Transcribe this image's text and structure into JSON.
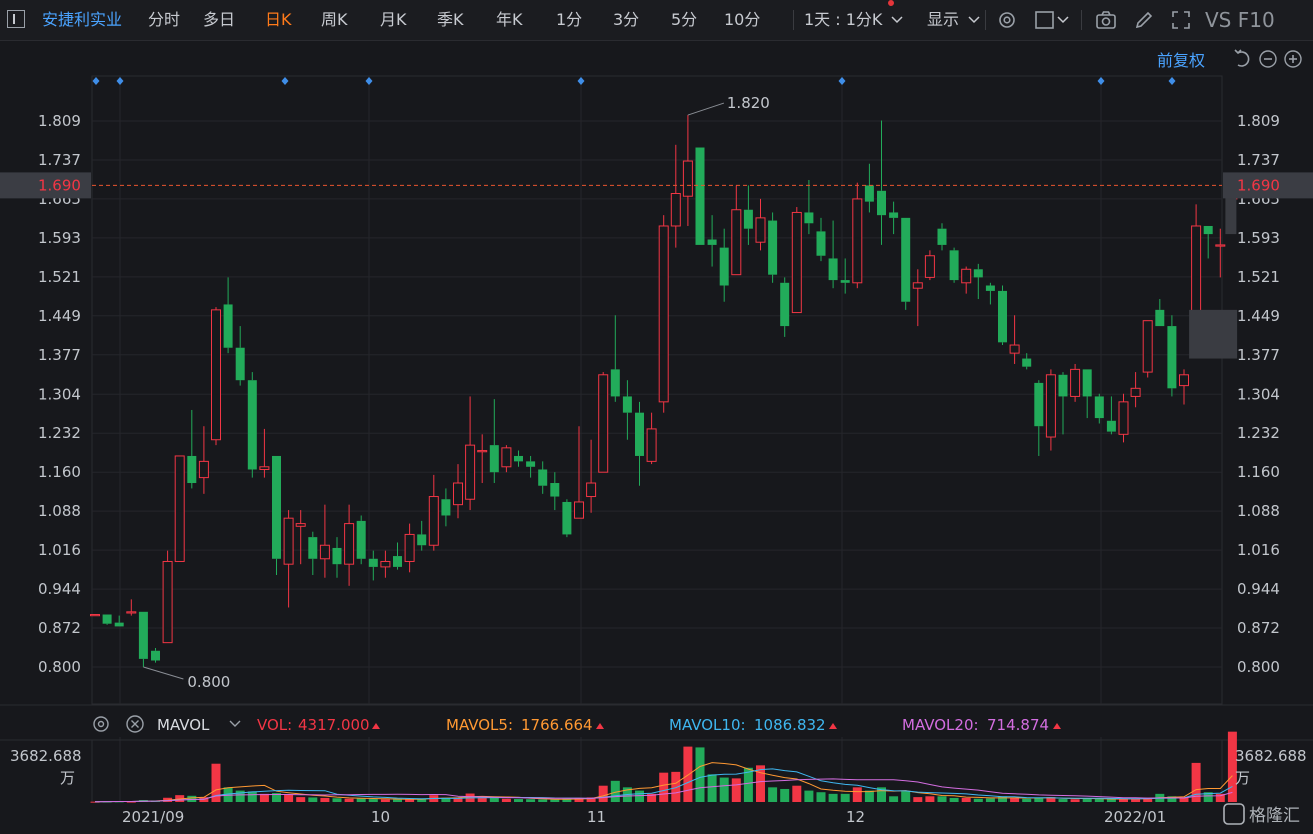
{
  "toolbar": {
    "stock_name": "安捷利实业",
    "tabs": [
      "分时",
      "多日",
      "日K",
      "周K",
      "月K",
      "季K",
      "年K",
      "1分",
      "3分",
      "5分",
      "10分"
    ],
    "active_tab": "日K",
    "interval": "1天 : 1分K",
    "display": "显示",
    "right_text": "VS F10",
    "adjust": "前复权"
  },
  "colors": {
    "up": "#f23645",
    "down": "#22ab5a",
    "bg": "#17181c",
    "price_line": "#e8532e",
    "mavol5": "#ff9933",
    "mavol10": "#3fb7f0",
    "mavol20": "#d36de0"
  },
  "main_axis": {
    "ticks": [
      "1.809",
      "1.737",
      "1.665",
      "1.593",
      "1.521",
      "1.449",
      "1.377",
      "1.304",
      "1.232",
      "1.160",
      "1.088",
      "1.016",
      "0.944",
      "0.872",
      "0.800"
    ],
    "current_price": "1.690",
    "max_label": "1.820",
    "min_label": "0.800"
  },
  "x_labels": [
    "2021/09",
    "10",
    "11",
    "12",
    "2022/01"
  ],
  "volume_legend": {
    "name": "MAVOL",
    "vol_label": "VOL:",
    "vol_value": "4317.000",
    "mavol5_label": "MAVOL5:",
    "mavol5_value": "1766.664",
    "mavol10_label": "MAVOL10:",
    "mavol10_value": "1086.832",
    "mavol20_label": "MAVOL20:",
    "mavol20_value": "714.874"
  },
  "volume_axis": {
    "top": "3682.688",
    "unit": "万"
  },
  "watermark": "格隆汇",
  "chart_data": {
    "type": "candlestick",
    "title": "安捷利实业",
    "period": "日K",
    "ylim": [
      0.77,
      1.84
    ],
    "x_ticks": [
      "2021/09",
      "10",
      "11",
      "12",
      "2022/01"
    ],
    "candles": [
      {
        "o": 0.897,
        "h": 0.897,
        "l": 0.897,
        "c": 0.897,
        "v": 20
      },
      {
        "o": 0.897,
        "h": 0.897,
        "l": 0.878,
        "c": 0.88,
        "v": 30
      },
      {
        "o": 0.882,
        "h": 0.895,
        "l": 0.875,
        "c": 0.875,
        "v": 40
      },
      {
        "o": 0.9,
        "h": 0.925,
        "l": 0.895,
        "c": 0.902,
        "v": 25
      },
      {
        "o": 0.902,
        "h": 0.902,
        "l": 0.8,
        "c": 0.815,
        "v": 120
      },
      {
        "o": 0.83,
        "h": 0.835,
        "l": 0.808,
        "c": 0.812,
        "v": 90
      },
      {
        "o": 0.845,
        "h": 1.015,
        "l": 0.845,
        "c": 0.995,
        "v": 260
      },
      {
        "o": 0.995,
        "h": 1.19,
        "l": 0.995,
        "c": 1.19,
        "v": 420
      },
      {
        "o": 1.19,
        "h": 1.275,
        "l": 1.13,
        "c": 1.14,
        "v": 380
      },
      {
        "o": 1.15,
        "h": 1.245,
        "l": 1.12,
        "c": 1.18,
        "v": 300
      },
      {
        "o": 1.22,
        "h": 1.465,
        "l": 1.21,
        "c": 1.46,
        "v": 2350
      },
      {
        "o": 1.47,
        "h": 1.52,
        "l": 1.38,
        "c": 1.39,
        "v": 900
      },
      {
        "o": 1.39,
        "h": 1.43,
        "l": 1.32,
        "c": 1.33,
        "v": 700
      },
      {
        "o": 1.33,
        "h": 1.345,
        "l": 1.15,
        "c": 1.165,
        "v": 650
      },
      {
        "o": 1.165,
        "h": 1.24,
        "l": 1.15,
        "c": 1.17,
        "v": 500
      },
      {
        "o": 1.19,
        "h": 1.19,
        "l": 0.97,
        "c": 1.0,
        "v": 550
      },
      {
        "o": 0.99,
        "h": 1.09,
        "l": 0.91,
        "c": 1.075,
        "v": 450
      },
      {
        "o": 1.06,
        "h": 1.09,
        "l": 0.99,
        "c": 1.065,
        "v": 300
      },
      {
        "o": 1.04,
        "h": 1.05,
        "l": 0.97,
        "c": 1.0,
        "v": 280
      },
      {
        "o": 1.0,
        "h": 1.1,
        "l": 0.965,
        "c": 1.025,
        "v": 250
      },
      {
        "o": 1.02,
        "h": 1.04,
        "l": 0.965,
        "c": 0.99,
        "v": 230
      },
      {
        "o": 0.99,
        "h": 1.1,
        "l": 0.95,
        "c": 1.065,
        "v": 200
      },
      {
        "o": 1.07,
        "h": 1.08,
        "l": 0.99,
        "c": 1.0,
        "v": 210
      },
      {
        "o": 1.0,
        "h": 1.015,
        "l": 0.96,
        "c": 0.985,
        "v": 180
      },
      {
        "o": 0.985,
        "h": 1.015,
        "l": 0.965,
        "c": 0.995,
        "v": 160
      },
      {
        "o": 1.005,
        "h": 1.03,
        "l": 0.98,
        "c": 0.985,
        "v": 150
      },
      {
        "o": 0.995,
        "h": 1.065,
        "l": 0.975,
        "c": 1.045,
        "v": 170
      },
      {
        "o": 1.045,
        "h": 1.07,
        "l": 1.015,
        "c": 1.025,
        "v": 200
      },
      {
        "o": 1.025,
        "h": 1.155,
        "l": 1.015,
        "c": 1.115,
        "v": 420
      },
      {
        "o": 1.11,
        "h": 1.13,
        "l": 1.06,
        "c": 1.08,
        "v": 260
      },
      {
        "o": 1.1,
        "h": 1.175,
        "l": 1.075,
        "c": 1.14,
        "v": 230
      },
      {
        "o": 1.11,
        "h": 1.3,
        "l": 1.09,
        "c": 1.21,
        "v": 520
      },
      {
        "o": 1.2,
        "h": 1.23,
        "l": 1.14,
        "c": 1.2,
        "v": 300
      },
      {
        "o": 1.21,
        "h": 1.295,
        "l": 1.14,
        "c": 1.16,
        "v": 280
      },
      {
        "o": 1.17,
        "h": 1.21,
        "l": 1.16,
        "c": 1.205,
        "v": 200
      },
      {
        "o": 1.19,
        "h": 1.2,
        "l": 1.17,
        "c": 1.18,
        "v": 180
      },
      {
        "o": 1.18,
        "h": 1.19,
        "l": 1.15,
        "c": 1.17,
        "v": 170
      },
      {
        "o": 1.165,
        "h": 1.18,
        "l": 1.12,
        "c": 1.135,
        "v": 160
      },
      {
        "o": 1.14,
        "h": 1.16,
        "l": 1.09,
        "c": 1.115,
        "v": 150
      },
      {
        "o": 1.105,
        "h": 1.11,
        "l": 1.04,
        "c": 1.045,
        "v": 200
      },
      {
        "o": 1.075,
        "h": 1.245,
        "l": 1.075,
        "c": 1.105,
        "v": 240
      },
      {
        "o": 1.115,
        "h": 1.22,
        "l": 1.085,
        "c": 1.14,
        "v": 280
      },
      {
        "o": 1.16,
        "h": 1.345,
        "l": 1.16,
        "c": 1.34,
        "v": 1000
      },
      {
        "o": 1.35,
        "h": 1.45,
        "l": 1.29,
        "c": 1.3,
        "v": 1300
      },
      {
        "o": 1.3,
        "h": 1.33,
        "l": 1.22,
        "c": 1.27,
        "v": 900
      },
      {
        "o": 1.27,
        "h": 1.29,
        "l": 1.135,
        "c": 1.19,
        "v": 700
      },
      {
        "o": 1.18,
        "h": 1.27,
        "l": 1.175,
        "c": 1.24,
        "v": 500
      },
      {
        "o": 1.29,
        "h": 1.635,
        "l": 1.27,
        "c": 1.615,
        "v": 1800
      },
      {
        "o": 1.615,
        "h": 1.765,
        "l": 1.575,
        "c": 1.675,
        "v": 1850
      },
      {
        "o": 1.67,
        "h": 1.82,
        "l": 1.615,
        "c": 1.735,
        "v": 3400
      },
      {
        "o": 1.76,
        "h": 1.76,
        "l": 1.58,
        "c": 1.58,
        "v": 3350
      },
      {
        "o": 1.59,
        "h": 1.635,
        "l": 1.54,
        "c": 1.58,
        "v": 1700
      },
      {
        "o": 1.575,
        "h": 1.61,
        "l": 1.475,
        "c": 1.505,
        "v": 1500
      },
      {
        "o": 1.525,
        "h": 1.69,
        "l": 1.525,
        "c": 1.645,
        "v": 1450
      },
      {
        "o": 1.645,
        "h": 1.69,
        "l": 1.58,
        "c": 1.61,
        "v": 2100
      },
      {
        "o": 1.585,
        "h": 1.665,
        "l": 1.57,
        "c": 1.63,
        "v": 2250
      },
      {
        "o": 1.625,
        "h": 1.64,
        "l": 1.51,
        "c": 1.525,
        "v": 900
      },
      {
        "o": 1.51,
        "h": 1.52,
        "l": 1.41,
        "c": 1.43,
        "v": 800
      },
      {
        "o": 1.455,
        "h": 1.65,
        "l": 1.455,
        "c": 1.64,
        "v": 1000
      },
      {
        "o": 1.64,
        "h": 1.7,
        "l": 1.6,
        "c": 1.62,
        "v": 700
      },
      {
        "o": 1.605,
        "h": 1.63,
        "l": 1.55,
        "c": 1.56,
        "v": 600
      },
      {
        "o": 1.555,
        "h": 1.625,
        "l": 1.5,
        "c": 1.515,
        "v": 500
      },
      {
        "o": 1.515,
        "h": 1.555,
        "l": 1.49,
        "c": 1.51,
        "v": 500
      },
      {
        "o": 1.51,
        "h": 1.695,
        "l": 1.5,
        "c": 1.665,
        "v": 900
      },
      {
        "o": 1.69,
        "h": 1.73,
        "l": 1.64,
        "c": 1.66,
        "v": 700
      },
      {
        "o": 1.68,
        "h": 1.81,
        "l": 1.58,
        "c": 1.635,
        "v": 900
      },
      {
        "o": 1.64,
        "h": 1.66,
        "l": 1.6,
        "c": 1.63,
        "v": 350
      },
      {
        "o": 1.63,
        "h": 1.63,
        "l": 1.46,
        "c": 1.475,
        "v": 650
      },
      {
        "o": 1.5,
        "h": 1.535,
        "l": 1.43,
        "c": 1.51,
        "v": 300
      },
      {
        "o": 1.52,
        "h": 1.57,
        "l": 1.515,
        "c": 1.56,
        "v": 350
      },
      {
        "o": 1.61,
        "h": 1.62,
        "l": 1.57,
        "c": 1.58,
        "v": 350
      },
      {
        "o": 1.57,
        "h": 1.575,
        "l": 1.51,
        "c": 1.515,
        "v": 250
      },
      {
        "o": 1.51,
        "h": 1.54,
        "l": 1.49,
        "c": 1.535,
        "v": 250
      },
      {
        "o": 1.535,
        "h": 1.545,
        "l": 1.48,
        "c": 1.52,
        "v": 200
      },
      {
        "o": 1.505,
        "h": 1.51,
        "l": 1.47,
        "c": 1.495,
        "v": 220
      },
      {
        "o": 1.495,
        "h": 1.505,
        "l": 1.395,
        "c": 1.4,
        "v": 350
      },
      {
        "o": 1.38,
        "h": 1.45,
        "l": 1.36,
        "c": 1.395,
        "v": 250
      },
      {
        "o": 1.37,
        "h": 1.38,
        "l": 1.35,
        "c": 1.355,
        "v": 200
      },
      {
        "o": 1.325,
        "h": 1.33,
        "l": 1.19,
        "c": 1.245,
        "v": 220
      },
      {
        "o": 1.225,
        "h": 1.35,
        "l": 1.2,
        "c": 1.34,
        "v": 300
      },
      {
        "o": 1.34,
        "h": 1.345,
        "l": 1.23,
        "c": 1.3,
        "v": 180
      },
      {
        "o": 1.3,
        "h": 1.36,
        "l": 1.29,
        "c": 1.35,
        "v": 170
      },
      {
        "o": 1.35,
        "h": 1.35,
        "l": 1.26,
        "c": 1.3,
        "v": 200
      },
      {
        "o": 1.3,
        "h": 1.305,
        "l": 1.25,
        "c": 1.26,
        "v": 190
      },
      {
        "o": 1.255,
        "h": 1.3,
        "l": 1.23,
        "c": 1.235,
        "v": 180
      },
      {
        "o": 1.23,
        "h": 1.305,
        "l": 1.215,
        "c": 1.29,
        "v": 170
      },
      {
        "o": 1.3,
        "h": 1.345,
        "l": 1.28,
        "c": 1.315,
        "v": 200
      },
      {
        "o": 1.345,
        "h": 1.44,
        "l": 1.335,
        "c": 1.44,
        "v": 260
      },
      {
        "o": 1.46,
        "h": 1.48,
        "l": 1.43,
        "c": 1.43,
        "v": 500
      },
      {
        "o": 1.43,
        "h": 1.45,
        "l": 1.3,
        "c": 1.315,
        "v": 350
      },
      {
        "o": 1.32,
        "h": 1.35,
        "l": 1.285,
        "c": 1.34,
        "v": 300
      },
      {
        "o": 1.455,
        "h": 1.655,
        "l": 1.45,
        "c": 1.615,
        "v": 2400
      },
      {
        "o": 1.615,
        "h": 1.615,
        "l": 1.555,
        "c": 1.6,
        "v": 600
      },
      {
        "o": 1.58,
        "h": 1.61,
        "l": 1.52,
        "c": 1.58,
        "v": 500
      },
      {
        "o": 1.665,
        "h": 1.7,
        "l": 1.665,
        "c": 1.69,
        "v": 4317
      }
    ],
    "ghost_boxes": [
      {
        "index": 91,
        "from": 1.37,
        "to": 1.46
      },
      {
        "index": 94,
        "from": 1.6,
        "to": 1.67
      }
    ],
    "volume": {
      "unit": "万",
      "max_label": 3682.688
    }
  }
}
